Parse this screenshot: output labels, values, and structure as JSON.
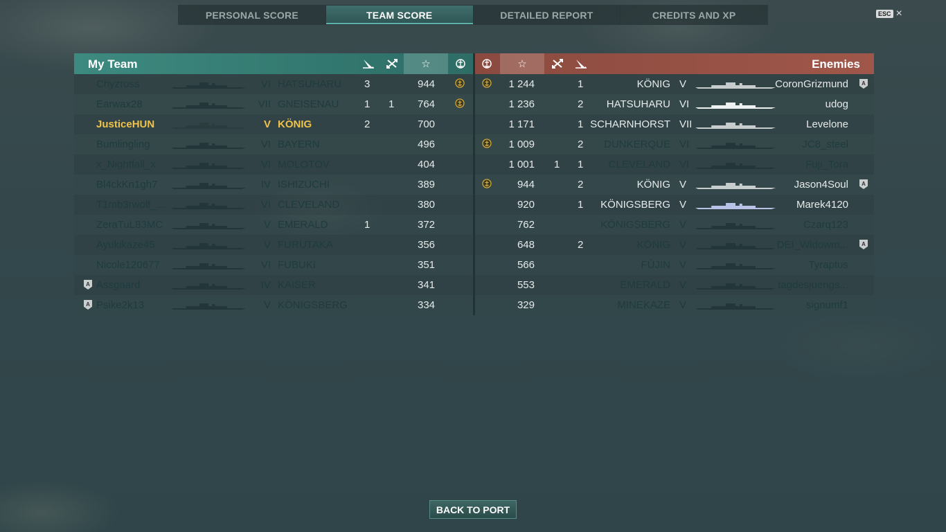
{
  "tabs": [
    {
      "label": "PERSONAL SCORE",
      "active": false
    },
    {
      "label": "TEAM SCORE",
      "active": true
    },
    {
      "label": "DETAILED REPORT",
      "active": false
    },
    {
      "label": "CREDITS AND XP",
      "active": false
    }
  ],
  "esc": {
    "key": "ESC",
    "close": "×"
  },
  "my_team": {
    "title": "My Team",
    "rows": [
      {
        "player": "Chyzross",
        "tier": "VI",
        "ship": "HATSUHARU",
        "a": "3",
        "b": "",
        "score": "944",
        "crest": true,
        "state": "dim"
      },
      {
        "player": "Earwax28",
        "tier": "VII",
        "ship": "GNEISENAU",
        "a": "1",
        "b": "1",
        "score": "764",
        "crest": true,
        "state": "dim"
      },
      {
        "player": "JusticeHUN",
        "tier": "V",
        "ship": "KÖNIG",
        "a": "2",
        "b": "",
        "score": "700",
        "crest": false,
        "state": "self"
      },
      {
        "player": "Bumlingling",
        "tier": "VI",
        "ship": "BAYERN",
        "a": "",
        "b": "",
        "score": "496",
        "crest": false,
        "state": "dim"
      },
      {
        "player": "x_Nightfall_x",
        "tier": "VI",
        "ship": "MOLOTOV",
        "a": "",
        "b": "",
        "score": "404",
        "crest": false,
        "state": "dim"
      },
      {
        "player": "Bl4ckKn1gh7",
        "tier": "IV",
        "ship": "ISHIZUCHI",
        "a": "",
        "b": "",
        "score": "389",
        "crest": false,
        "state": "dim"
      },
      {
        "player": "T1mb3rwolf_...",
        "tier": "VI",
        "ship": "CLEVELAND",
        "a": "",
        "b": "",
        "score": "380",
        "crest": false,
        "state": "dim"
      },
      {
        "player": "ZeraTuL83MC",
        "tier": "V",
        "ship": "EMERALD",
        "a": "1",
        "b": "",
        "score": "372",
        "crest": false,
        "state": "dim"
      },
      {
        "player": "Ayukikaze45",
        "tier": "V",
        "ship": "FURUTAKA",
        "a": "",
        "b": "",
        "score": "356",
        "crest": false,
        "state": "dim"
      },
      {
        "player": "Nicole120677",
        "tier": "VI",
        "ship": "FUBUKI",
        "a": "",
        "b": "",
        "score": "351",
        "crest": false,
        "state": "dim"
      },
      {
        "player": "Assgaard",
        "tier": "IV",
        "ship": "KAISER",
        "a": "",
        "b": "",
        "score": "341",
        "crest": false,
        "state": "dim",
        "badge": "A"
      },
      {
        "player": "Psike2k13",
        "tier": "V",
        "ship": "KÖNIGSBERG",
        "a": "",
        "b": "",
        "score": "334",
        "crest": false,
        "state": "dim",
        "badge": "A"
      }
    ]
  },
  "enemies": {
    "title": "Enemies",
    "rows": [
      {
        "player": "CoronGrizmund",
        "tier": "V",
        "ship": "KÖNIG",
        "a": "1",
        "b": "",
        "score": "1 244",
        "crest": true,
        "state": "alive",
        "badge": "A"
      },
      {
        "player": "udog",
        "tier": "VI",
        "ship": "HATSUHARU",
        "a": "2",
        "b": "",
        "score": "1 236",
        "crest": false,
        "state": "alive"
      },
      {
        "player": "Levelone",
        "tier": "VII",
        "ship": "SCHARNHORST",
        "a": "1",
        "b": "",
        "score": "1 171",
        "crest": false,
        "state": "alive"
      },
      {
        "player": "JC8_steel",
        "tier": "VI",
        "ship": "DUNKERQUE",
        "a": "2",
        "b": "",
        "score": "1 009",
        "crest": true,
        "state": "dim"
      },
      {
        "player": "Fuji_Tora",
        "tier": "VI",
        "ship": "CLEVELAND",
        "a": "1",
        "b": "1",
        "score": "1 001",
        "crest": false,
        "state": "dim"
      },
      {
        "player": "Jason4Soul",
        "tier": "V",
        "ship": "KÖNIG",
        "a": "2",
        "b": "",
        "score": "944",
        "crest": true,
        "state": "alive",
        "badge": "A"
      },
      {
        "player": "Marek4120",
        "tier": "V",
        "ship": "KÖNIGSBERG",
        "a": "1",
        "b": "",
        "score": "920",
        "crest": false,
        "state": "alive"
      },
      {
        "player": "Czarq123",
        "tier": "V",
        "ship": "KÖNIGSBERG",
        "a": "",
        "b": "",
        "score": "762",
        "crest": false,
        "state": "dim"
      },
      {
        "player": "DEI_Widowm...",
        "tier": "V",
        "ship": "KÖNIG",
        "a": "2",
        "b": "",
        "score": "648",
        "crest": false,
        "state": "dim",
        "badge": "A"
      },
      {
        "player": "Tyraptus",
        "tier": "V",
        "ship": "FŪJIN",
        "a": "",
        "b": "",
        "score": "566",
        "crest": false,
        "state": "dim"
      },
      {
        "player": "tagdesjuengs...",
        "tier": "V",
        "ship": "EMERALD",
        "a": "",
        "b": "",
        "score": "553",
        "crest": false,
        "state": "dim"
      },
      {
        "player": "signumf1",
        "tier": "V",
        "ship": "MINEKAZE",
        "a": "",
        "b": "",
        "score": "329",
        "crest": false,
        "state": "dim"
      }
    ]
  },
  "header_icons": {
    "torpedo": "torpedo-icon",
    "plane": "plane-icon",
    "star": "☆",
    "crest": "crest-icon"
  },
  "back_button": "BACK TO PORT"
}
